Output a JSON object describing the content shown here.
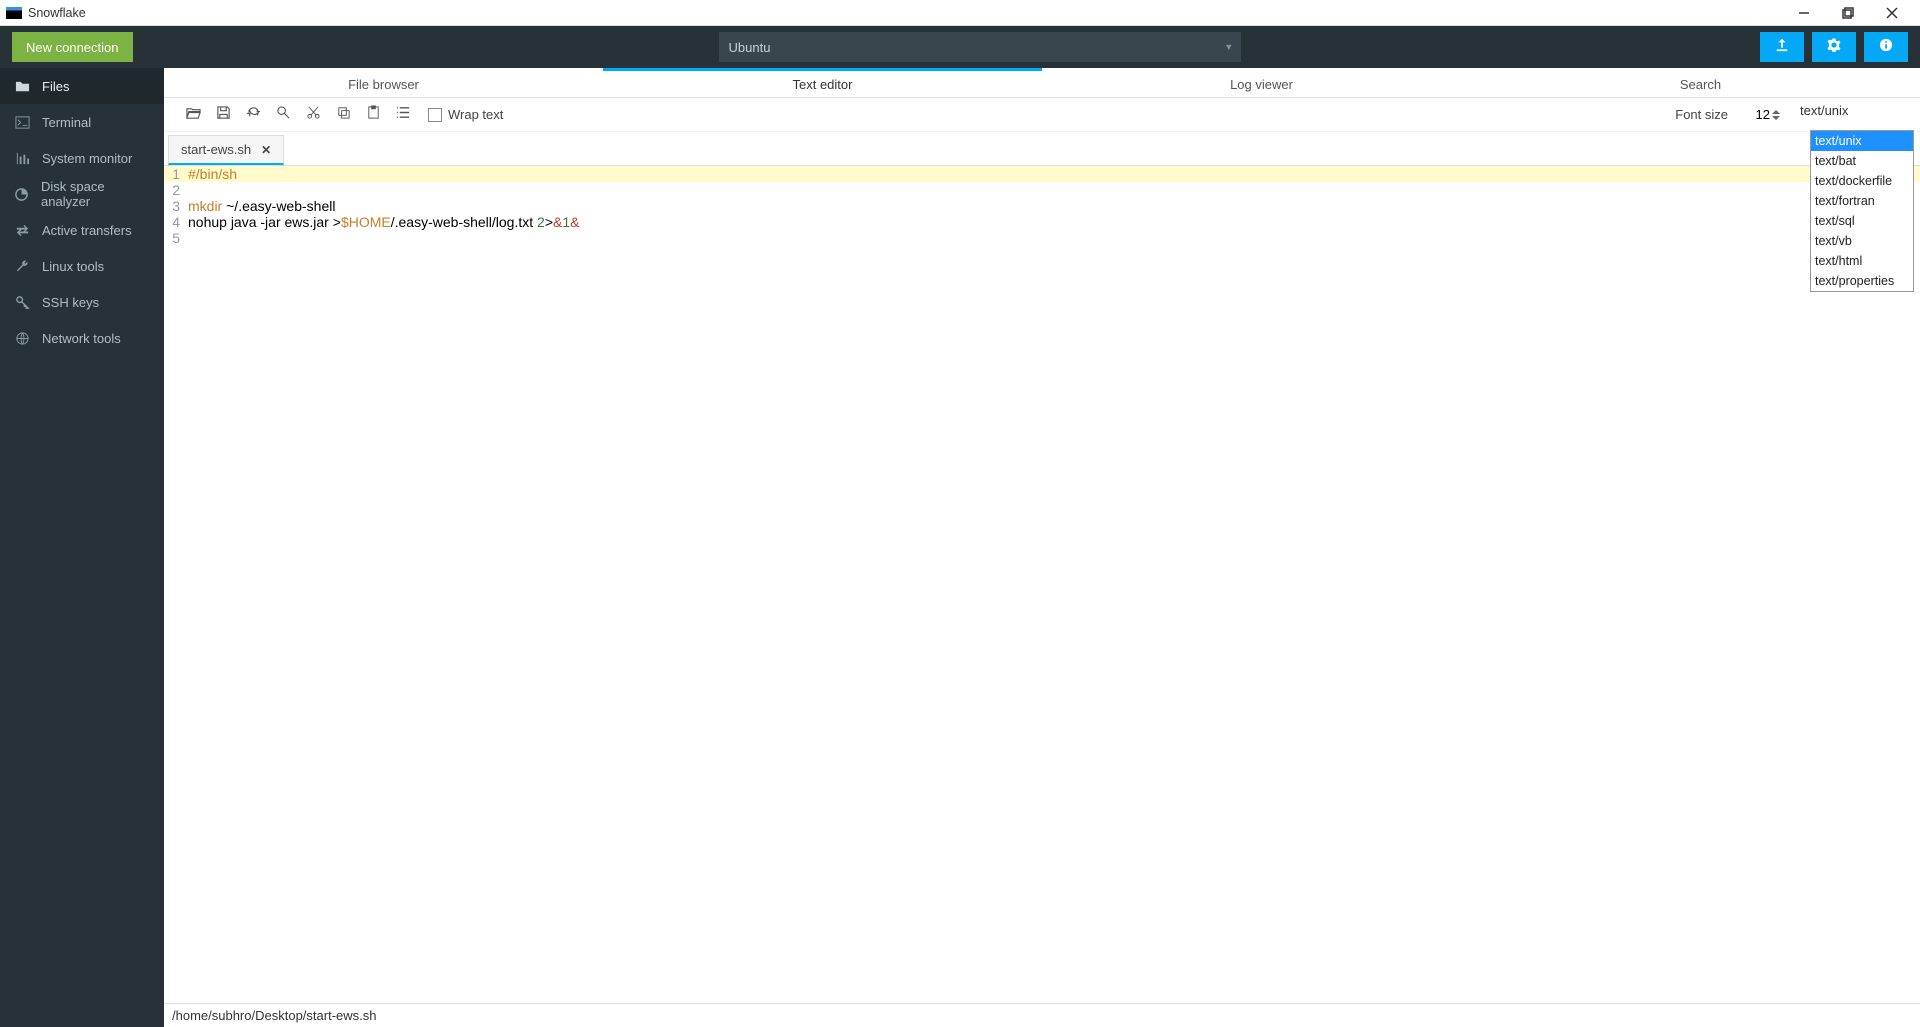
{
  "window": {
    "title": "Snowflake"
  },
  "header": {
    "new_connection": "New connection",
    "connection_selected": "Ubuntu"
  },
  "sidebar": {
    "items": [
      {
        "label": "Files"
      },
      {
        "label": "Terminal"
      },
      {
        "label": "System monitor"
      },
      {
        "label": "Disk space analyzer"
      },
      {
        "label": "Active transfers"
      },
      {
        "label": "Linux tools"
      },
      {
        "label": "SSH keys"
      },
      {
        "label": "Network tools"
      }
    ]
  },
  "tabs": {
    "items": [
      {
        "label": "File browser"
      },
      {
        "label": "Text editor"
      },
      {
        "label": "Log viewer"
      },
      {
        "label": "Search"
      }
    ]
  },
  "toolbar": {
    "wrap_label": "Wrap text",
    "font_label": "Font size",
    "font_value": "12",
    "syntax_value": "text/unix"
  },
  "syntax_options": [
    "text/unix",
    "text/bat",
    "text/dockerfile",
    "text/fortran",
    "text/sql",
    "text/vb",
    "text/html",
    "text/properties"
  ],
  "filetabs": [
    {
      "name": "start-ews.sh"
    }
  ],
  "editor": {
    "lines": {
      "l1": {
        "n": "1",
        "t1": "#/bin/sh"
      },
      "l2": {
        "n": "2"
      },
      "l3": {
        "n": "3",
        "t1": "mkdir",
        "t2": " ~/.easy-web-shell"
      },
      "l4": {
        "n": "4",
        "t1": "nohup java -jar ews.jar >",
        "t2": "$HOME",
        "t3": "/.easy-web-shell/log.txt ",
        "t4": "2",
        "t5": ">",
        "t6": "&",
        "t7": "1",
        "t8": "&"
      },
      "l5": {
        "n": "5"
      }
    }
  },
  "status": {
    "path": "/home/subhro/Desktop/start-ews.sh"
  }
}
